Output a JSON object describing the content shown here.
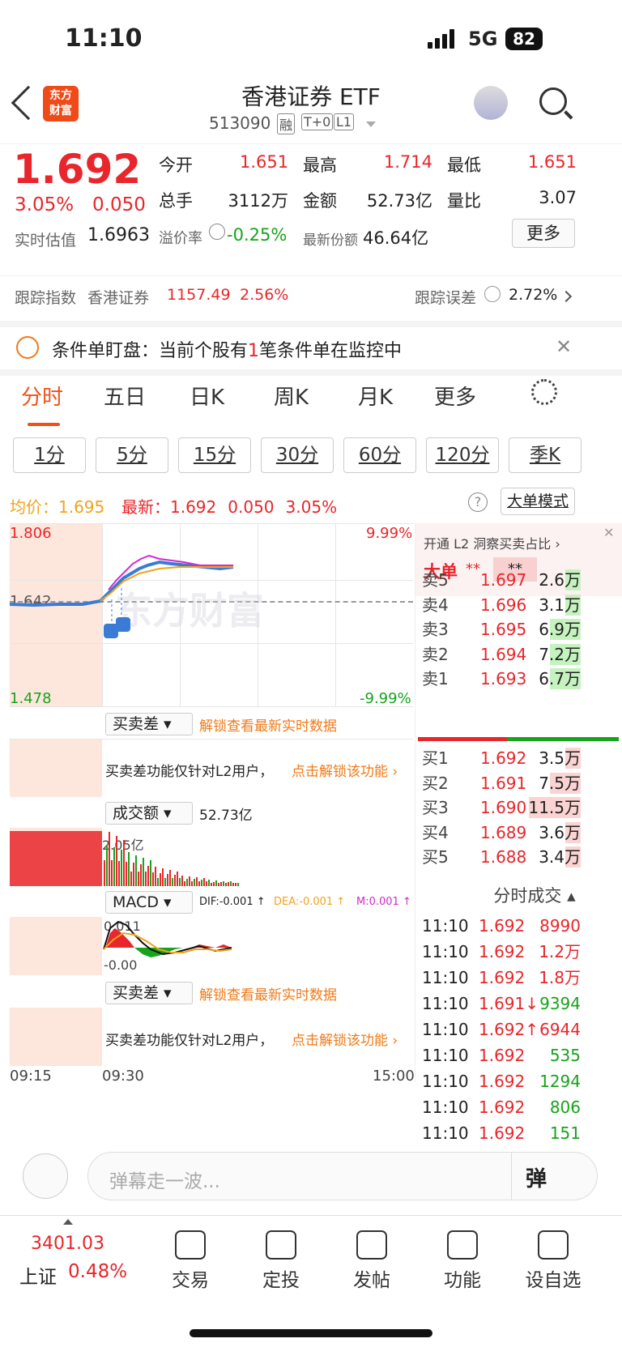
{
  "status": {
    "time": "11:10",
    "network": "5G",
    "battery": "82"
  },
  "header": {
    "logo_line1": "东方",
    "logo_line2": "财富",
    "title": "香港证券 ETF",
    "code": "513090",
    "tag1": "融",
    "tag2": "T+0",
    "tag3": "L1"
  },
  "quote": {
    "price": "1.692",
    "pct": "3.05%",
    "chg": "0.050",
    "open_label": "今开",
    "open": "1.651",
    "high_label": "最高",
    "high": "1.714",
    "low_label": "最低",
    "low": "1.651",
    "vol_label": "总手",
    "vol": "3112万",
    "amt_label": "金额",
    "amt": "52.73亿",
    "ratio_label": "量比",
    "ratio": "3.07",
    "est_label": "实时估值",
    "est": "1.6963",
    "premium_label": "溢价率",
    "premium": "-0.25%",
    "share_label": "最新份额",
    "share": "46.64亿",
    "more": "更多"
  },
  "track": {
    "label": "跟踪指数",
    "index": "香港证券",
    "value": "1157.49",
    "pct": "2.56%",
    "err_label": "跟踪误差",
    "err": "2.72%"
  },
  "banner": {
    "text_a": "条件单盯盘：当前个股有",
    "num": "1",
    "text_b": "笔条件单在监控中"
  },
  "tabs": [
    "分时",
    "五日",
    "日K",
    "周K",
    "月K",
    "更多"
  ],
  "periods": [
    "1分",
    "5分",
    "15分",
    "30分",
    "60分",
    "120分",
    "季K"
  ],
  "chart_head": {
    "avg_label": "均价：",
    "avg": "1.695",
    "last_label": "最新：",
    "last": "1.692",
    "chg": "0.050",
    "pct": "3.05%",
    "mode": "大单模式"
  },
  "chart": {
    "ymax": "1.806",
    "ymid": "1.642",
    "ymin": "1.478",
    "pmax": "9.99%",
    "pmin": "-9.99%",
    "watermark": "东方财富",
    "sub1": "买卖差",
    "unlock": "解锁查看最新实时数据",
    "l2_note": "买卖差功能仅针对L2用户，",
    "l2_link": "点击解锁该功能",
    "sub2": "成交额",
    "sub2_val": "52.73亿",
    "vol_peak": "2.05亿",
    "sub3": "MACD",
    "dif": "DIF:-0.001 ↑",
    "dea": "DEA:-0.001 ↑",
    "m": "M:0.001 ↑",
    "macd_top": "0.011",
    "macd_bot": "-0.00",
    "sub4": "买卖差",
    "t0": "09:15",
    "t1": "09:30",
    "t2": "15:00"
  },
  "orderbook": {
    "l2": "开通 L2 洞察买卖占比 ›",
    "big": "大单",
    "stars1": "**",
    "stars2": "**",
    "asks": [
      {
        "l": "卖5",
        "p": "1.697",
        "v": "2.6万",
        "f": 0.3
      },
      {
        "l": "卖4",
        "p": "1.696",
        "v": "3.1万",
        "f": 0.3
      },
      {
        "l": "卖3",
        "p": "1.695",
        "v": "6.9万",
        "f": 0.6
      },
      {
        "l": "卖2",
        "p": "1.694",
        "v": "7.2万",
        "f": 0.6
      },
      {
        "l": "卖1",
        "p": "1.693",
        "v": "6.7万",
        "f": 0.6
      }
    ],
    "bids": [
      {
        "l": "买1",
        "p": "1.692",
        "v": "3.5万",
        "f": 0.3
      },
      {
        "l": "买2",
        "p": "1.691",
        "v": "7.5万",
        "f": 0.6
      },
      {
        "l": "买3",
        "p": "1.690",
        "v": "11.5万",
        "f": 1.0
      },
      {
        "l": "买4",
        "p": "1.689",
        "v": "3.6万",
        "f": 0.3
      },
      {
        "l": "买5",
        "p": "1.688",
        "v": "3.4万",
        "f": 0.3
      }
    ],
    "ticks_title": "分时成交",
    "ticks": [
      {
        "t": "11:10",
        "p": "1.692",
        "v": "8990",
        "c": "red"
      },
      {
        "t": "11:10",
        "p": "1.692",
        "v": "1.2万",
        "c": "red"
      },
      {
        "t": "11:10",
        "p": "1.692",
        "v": "1.8万",
        "c": "red"
      },
      {
        "t": "11:10",
        "p": "1.691↓",
        "v": "9394",
        "c": "green"
      },
      {
        "t": "11:10",
        "p": "1.692↑",
        "v": "6944",
        "c": "red"
      },
      {
        "t": "11:10",
        "p": "1.692",
        "v": "535",
        "c": "green"
      },
      {
        "t": "11:10",
        "p": "1.692",
        "v": "1294",
        "c": "green"
      },
      {
        "t": "11:10",
        "p": "1.692",
        "v": "806",
        "c": "green"
      },
      {
        "t": "11:10",
        "p": "1.692",
        "v": "151",
        "c": "green"
      }
    ]
  },
  "comment": {
    "placeholder": "弹幕走一波...",
    "btn": "弹"
  },
  "footer": {
    "index_val": "3401.03",
    "index_name": "上证",
    "index_pct": "0.48%",
    "nav": [
      "交易",
      "定投",
      "发帖",
      "功能",
      "设自选"
    ]
  }
}
